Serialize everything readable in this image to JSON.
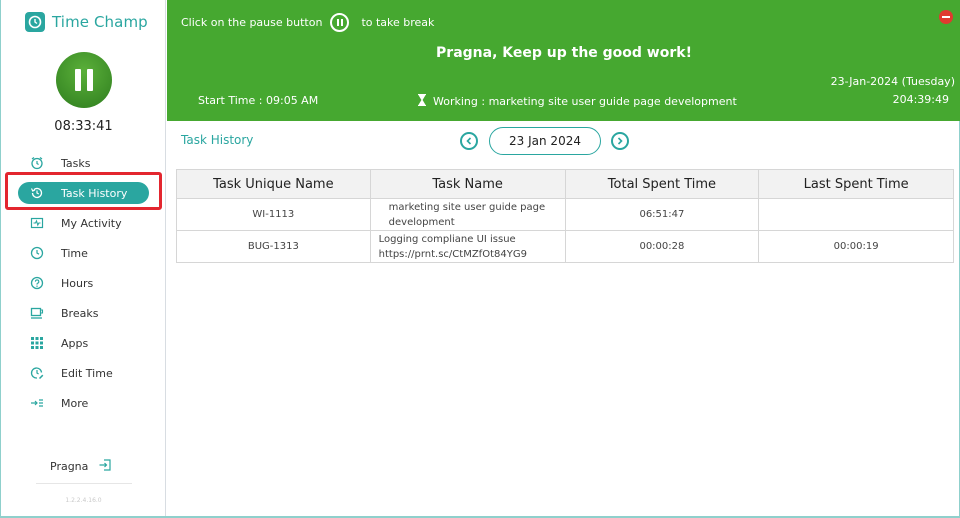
{
  "app": {
    "name": "Time Champ"
  },
  "sidebar": {
    "timer": "08:33:41",
    "items": [
      {
        "label": "Tasks",
        "icon": "alarm-clock-icon"
      },
      {
        "label": "Task History",
        "icon": "history-icon",
        "active": true
      },
      {
        "label": "My Activity",
        "icon": "activity-icon"
      },
      {
        "label": "Time",
        "icon": "clock-icon"
      },
      {
        "label": "Hours",
        "icon": "question-circle-icon"
      },
      {
        "label": "Breaks",
        "icon": "coffee-icon"
      },
      {
        "label": "Apps",
        "icon": "apps-grid-icon"
      },
      {
        "label": "Edit Time",
        "icon": "edit-time-icon"
      },
      {
        "label": "More",
        "icon": "more-icon"
      }
    ],
    "user": "Pragna",
    "version": "1.2.2.4.16.0"
  },
  "header": {
    "hint_prefix": "Click on the pause button",
    "hint_suffix": "to take break",
    "motto": "Pragna, Keep up the good work!",
    "date": "23-Jan-2024 (Tuesday)",
    "start_time": "Start Time : 09:05 AM",
    "working": "Working : marketing site user guide page development",
    "total": "204:39:49"
  },
  "task_history": {
    "title": "Task History",
    "date": "23 Jan 2024",
    "columns": [
      "Task Unique Name",
      "Task Name",
      "Total Spent Time",
      "Last Spent Time"
    ],
    "rows": [
      {
        "unique": "WI-1113",
        "name": "marketing site user guide page development",
        "total": "06:51:47",
        "last": ""
      },
      {
        "unique": "BUG-1313",
        "name": "Logging compliane UI issue https://prnt.sc/CtMZfOt84YG9",
        "total": "00:00:28",
        "last": "00:00:19"
      }
    ]
  },
  "colors": {
    "accent": "#2aa6a0",
    "header": "#46a830",
    "highlight": "#e3262f"
  }
}
